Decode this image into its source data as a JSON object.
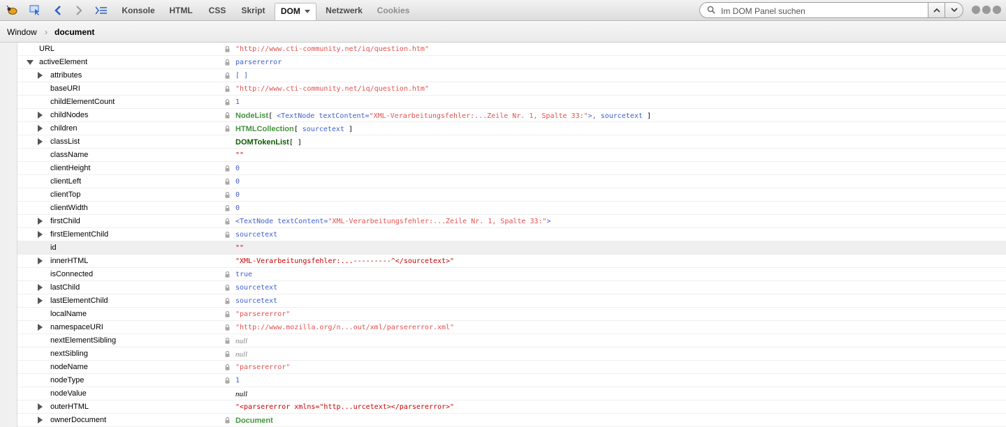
{
  "toolbar": {
    "icons": [
      "firebug-icon",
      "inspect-icon",
      "back-arrow-icon",
      "forward-arrow-icon",
      "command-line-icon"
    ],
    "tabs": [
      {
        "label": "Konsole"
      },
      {
        "label": "HTML"
      },
      {
        "label": "CSS"
      },
      {
        "label": "Skript"
      },
      {
        "label": "DOM",
        "active": true
      },
      {
        "label": "Netzwerk"
      },
      {
        "label": "Cookies"
      }
    ],
    "search_placeholder": "Im DOM Panel suchen"
  },
  "breadcrumb": {
    "root": "Window",
    "current": "document"
  },
  "colors": {
    "string": "#e5504e",
    "object": "#3e5fce",
    "type": "#45933f"
  },
  "rows": [
    {
      "name": "URL",
      "twisty": "none",
      "lock": true,
      "parts": [
        {
          "t": "\"http://www.cti-community.net/iq/question.htm\"",
          "c": "v-string"
        }
      ]
    },
    {
      "name": "activeElement",
      "twisty": "open",
      "lock": true,
      "parts": [
        {
          "t": "parsererror",
          "c": "v-obj"
        }
      ]
    },
    {
      "name": "attributes",
      "twisty": "closed",
      "lock": true,
      "parts": [
        {
          "t": "[ ]",
          "c": "v-obj"
        }
      ]
    },
    {
      "name": "baseURI",
      "twisty": "none",
      "lock": true,
      "parts": [
        {
          "t": "\"http://www.cti-community.net/iq/question.htm\"",
          "c": "v-string"
        }
      ]
    },
    {
      "name": "childElementCount",
      "twisty": "none",
      "lock": true,
      "parts": [
        {
          "t": "1",
          "c": "v-num"
        }
      ]
    },
    {
      "name": "childNodes",
      "twisty": "closed",
      "lock": true,
      "parts": [
        {
          "t": "NodeList",
          "c": "v-type"
        },
        {
          "t": "[ ",
          "c": "v-punct"
        },
        {
          "t": "<TextNode textContent=",
          "c": "v-obj"
        },
        {
          "t": "\"XML-Verarbeitungsfehler:...Zeile Nr. 1, Spalte 33:\"",
          "c": "v-string"
        },
        {
          "t": ">, sourcetext",
          "c": "v-obj"
        },
        {
          "t": " ]",
          "c": "v-punct"
        }
      ]
    },
    {
      "name": "children",
      "twisty": "closed",
      "lock": true,
      "parts": [
        {
          "t": "HTMLCollection",
          "c": "v-type"
        },
        {
          "t": "[ ",
          "c": "v-punct"
        },
        {
          "t": "sourcetext",
          "c": "v-obj"
        },
        {
          "t": " ]",
          "c": "v-punct"
        }
      ]
    },
    {
      "name": "classList",
      "twisty": "closed",
      "lock": false,
      "parts": [
        {
          "t": "DOMTokenList",
          "c": "v-type-dark"
        },
        {
          "t": "[ ]",
          "c": "v-punct"
        }
      ]
    },
    {
      "name": "className",
      "twisty": "none",
      "lock": false,
      "parts": [
        {
          "t": "\"\"",
          "c": "v-string-bold"
        }
      ]
    },
    {
      "name": "clientHeight",
      "twisty": "none",
      "lock": true,
      "parts": [
        {
          "t": "0",
          "c": "v-num"
        }
      ]
    },
    {
      "name": "clientLeft",
      "twisty": "none",
      "lock": true,
      "parts": [
        {
          "t": "0",
          "c": "v-num"
        }
      ]
    },
    {
      "name": "clientTop",
      "twisty": "none",
      "lock": true,
      "parts": [
        {
          "t": "0",
          "c": "v-num"
        }
      ]
    },
    {
      "name": "clientWidth",
      "twisty": "none",
      "lock": true,
      "parts": [
        {
          "t": "0",
          "c": "v-num"
        }
      ]
    },
    {
      "name": "firstChild",
      "twisty": "closed",
      "lock": true,
      "parts": [
        {
          "t": "<TextNode textContent=",
          "c": "v-obj"
        },
        {
          "t": "\"XML-Verarbeitungsfehler:...Zeile Nr. 1, Spalte 33:\"",
          "c": "v-string"
        },
        {
          "t": ">",
          "c": "v-obj"
        }
      ]
    },
    {
      "name": "firstElementChild",
      "twisty": "closed",
      "lock": true,
      "parts": [
        {
          "t": "sourcetext",
          "c": "v-obj"
        }
      ]
    },
    {
      "name": "id",
      "twisty": "none",
      "lock": false,
      "selected": true,
      "parts": [
        {
          "t": "\"\"",
          "c": "v-string-bold"
        }
      ]
    },
    {
      "name": "innerHTML",
      "twisty": "closed",
      "lock": false,
      "parts": [
        {
          "t": "\"XML-Verarbeitungsfehler:...---------^</sourcetext>\"",
          "c": "v-string-bold"
        }
      ]
    },
    {
      "name": "isConnected",
      "twisty": "none",
      "lock": true,
      "parts": [
        {
          "t": "true",
          "c": "v-obj"
        }
      ]
    },
    {
      "name": "lastChild",
      "twisty": "closed",
      "lock": true,
      "parts": [
        {
          "t": "sourcetext",
          "c": "v-obj"
        }
      ]
    },
    {
      "name": "lastElementChild",
      "twisty": "closed",
      "lock": true,
      "parts": [
        {
          "t": "sourcetext",
          "c": "v-obj"
        }
      ]
    },
    {
      "name": "localName",
      "twisty": "none",
      "lock": true,
      "parts": [
        {
          "t": "\"parsererror\"",
          "c": "v-string"
        }
      ]
    },
    {
      "name": "namespaceURI",
      "twisty": "closed",
      "lock": true,
      "parts": [
        {
          "t": "\"http://www.mozilla.org/n...out/xml/parsererror.xml\"",
          "c": "v-string"
        }
      ]
    },
    {
      "name": "nextElementSibling",
      "twisty": "none",
      "lock": true,
      "parts": [
        {
          "t": "null",
          "c": "v-null"
        }
      ]
    },
    {
      "name": "nextSibling",
      "twisty": "none",
      "lock": true,
      "parts": [
        {
          "t": "null",
          "c": "v-null"
        }
      ]
    },
    {
      "name": "nodeName",
      "twisty": "none",
      "lock": true,
      "parts": [
        {
          "t": "\"parsererror\"",
          "c": "v-string"
        }
      ]
    },
    {
      "name": "nodeType",
      "twisty": "none",
      "lock": true,
      "parts": [
        {
          "t": "1",
          "c": "v-num"
        }
      ]
    },
    {
      "name": "nodeValue",
      "twisty": "none",
      "lock": false,
      "parts": [
        {
          "t": "null",
          "c": "v-null-dark"
        }
      ]
    },
    {
      "name": "outerHTML",
      "twisty": "closed",
      "lock": false,
      "parts": [
        {
          "t": "\"<parsererror xmlns=\"http...urcetext></parsererror>\"",
          "c": "v-string-bold"
        }
      ]
    },
    {
      "name": "ownerDocument",
      "twisty": "closed",
      "lock": true,
      "parts": [
        {
          "t": "Document",
          "c": "v-type"
        }
      ]
    }
  ]
}
